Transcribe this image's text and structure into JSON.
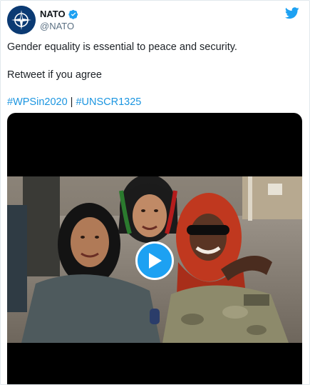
{
  "tweet": {
    "author_name": "NATO",
    "author_handle": "@NATO",
    "line1": "Gender equality is essential to peace and security.",
    "line2": "Retweet if you agree",
    "hashtags": [
      "#WPSin2020",
      "#UNSCR1325"
    ],
    "hashtag_separator": "|"
  },
  "icons": {
    "avatar": "nato-logo-icon",
    "verified": "verified-badge-icon",
    "brand": "twitter-bird-icon",
    "play": "play-icon"
  },
  "colors": {
    "link": "#1b95e0",
    "brand": "#1da1f2",
    "avatar_bg": "#0b3a73",
    "handle": "#5b7083"
  }
}
